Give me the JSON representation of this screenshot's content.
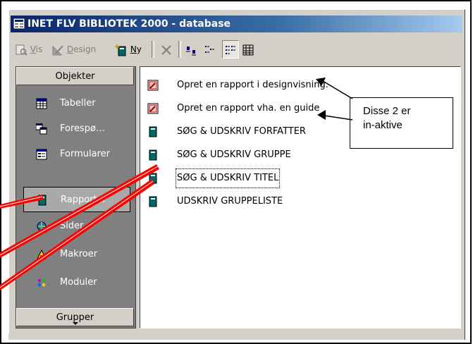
{
  "window": {
    "title": "INET FLV BIBLIOTEK 2000 - database"
  },
  "toolbar": {
    "vis_label": "Vis",
    "vis_underline": "V",
    "vis_rest": "is",
    "design_label": "Design",
    "design_underline": "D",
    "design_rest": "esign",
    "ny_label": "Ny",
    "ny_underline": "N",
    "ny_rest": "y"
  },
  "sidebar": {
    "objects_header": "Objekter",
    "groups_header": "Grupper",
    "items": [
      {
        "label": "Tabeller",
        "icon": "table-icon"
      },
      {
        "label": "Forespø…",
        "icon": "query-icon"
      },
      {
        "label": "Formularer",
        "icon": "form-icon"
      },
      {
        "label": "Rapporter",
        "icon": "report-icon",
        "active": true
      },
      {
        "label": "Sider",
        "icon": "page-icon"
      },
      {
        "label": "Makroer",
        "icon": "macro-icon"
      },
      {
        "label": "Moduler",
        "icon": "module-icon"
      }
    ]
  },
  "list": {
    "items": [
      {
        "label": "Opret en rapport i designvisning.",
        "icon": "wizard-icon"
      },
      {
        "label": "Opret en rapport vha. en guide",
        "icon": "wizard-icon"
      },
      {
        "label": "SØG & UDSKRIV FORFATTER",
        "icon": "report-icon"
      },
      {
        "label": "SØG & UDSKRIV GRUPPE",
        "icon": "report-icon"
      },
      {
        "label": "SØG & UDSKRIV TITEL",
        "icon": "report-icon",
        "focused": true
      },
      {
        "label": "UDSKRIV GRUPPELISTE",
        "icon": "report-icon"
      }
    ]
  },
  "callout": {
    "line1": "Disse 2 er",
    "line2": "in-aktive"
  },
  "colors": {
    "titlebar_start": "#0a246a",
    "titlebar_end": "#a6caf0",
    "panel": "#808080",
    "arrow": "#ff0000"
  }
}
